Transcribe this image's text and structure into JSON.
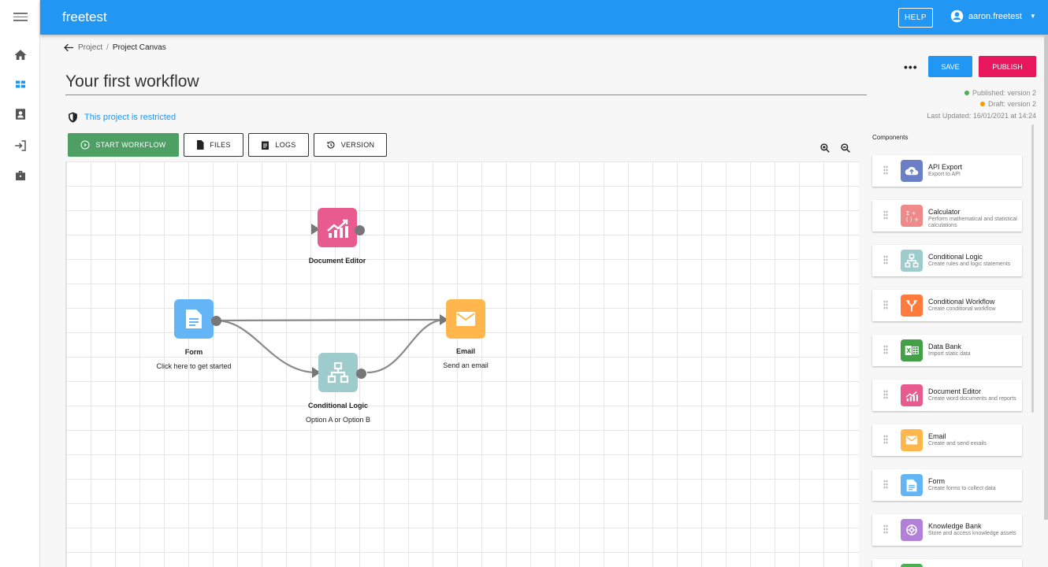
{
  "app": {
    "title": "freetest"
  },
  "header": {
    "help_label": "HELP",
    "user_name": "aaron.freetest"
  },
  "breadcrumb": {
    "parent": "Project",
    "separator": "/",
    "current": "Project Canvas"
  },
  "page": {
    "title": "Your first workflow",
    "restricted_text": "This project is restricted"
  },
  "toolbar": {
    "start_label": "START WORKFLOW",
    "files_label": "FILES",
    "logs_label": "LOGS",
    "version_label": "VERSION"
  },
  "actions": {
    "more_label": "•••",
    "save_label": "SAVE",
    "publish_label": "PUBLISH"
  },
  "status": {
    "published": "Published: version 2",
    "draft": "Draft: version 2",
    "last_updated": "Last Updated: 16/01/2021 at 14:24",
    "published_color": "#4caf50",
    "draft_color": "#ff9800"
  },
  "canvas_nodes": {
    "document_editor": {
      "label": "Document Editor",
      "color": "#e85b8f",
      "icon": "chart-icon"
    },
    "form": {
      "label": "Form",
      "sub": "Click here to get started",
      "color": "#64b5f6",
      "icon": "document-icon"
    },
    "conditional": {
      "label": "Conditional Logic",
      "sub": "Option A or Option B",
      "color": "#9ecbcb",
      "icon": "hierarchy-icon"
    },
    "email": {
      "label": "Email",
      "sub": "Send an email",
      "color": "#ffb74d",
      "icon": "mail-icon"
    }
  },
  "components": {
    "heading": "Components",
    "items": [
      {
        "name": "API Export",
        "desc": "Export to API",
        "color": "#6b7fc7",
        "icon": "cloud-upload-icon"
      },
      {
        "name": "Calculator",
        "desc": "Perform mathematical and statistical calculations",
        "color": "#ef8a8a",
        "icon": "calculator-icon"
      },
      {
        "name": "Conditional Logic",
        "desc": "Create rules and logic statements",
        "color": "#9ecbcb",
        "icon": "hierarchy-icon"
      },
      {
        "name": "Conditional Workflow",
        "desc": "Create conditional workflow",
        "color": "#ff7a3d",
        "icon": "fork-icon"
      },
      {
        "name": "Data Bank",
        "desc": "Import static data",
        "color": "#43a047",
        "icon": "excel-icon"
      },
      {
        "name": "Document Editor",
        "desc": "Create word documents and reports",
        "color": "#e85b8f",
        "icon": "chart-icon"
      },
      {
        "name": "Email",
        "desc": "Create and send emails",
        "color": "#ffb74d",
        "icon": "mail-icon"
      },
      {
        "name": "Form",
        "desc": "Create forms to collect data",
        "color": "#64b5f6",
        "icon": "document-icon"
      },
      {
        "name": "Knowledge Bank",
        "desc": "Store and access knowledge assets",
        "color": "#b380d9",
        "icon": "brain-icon"
      }
    ]
  }
}
